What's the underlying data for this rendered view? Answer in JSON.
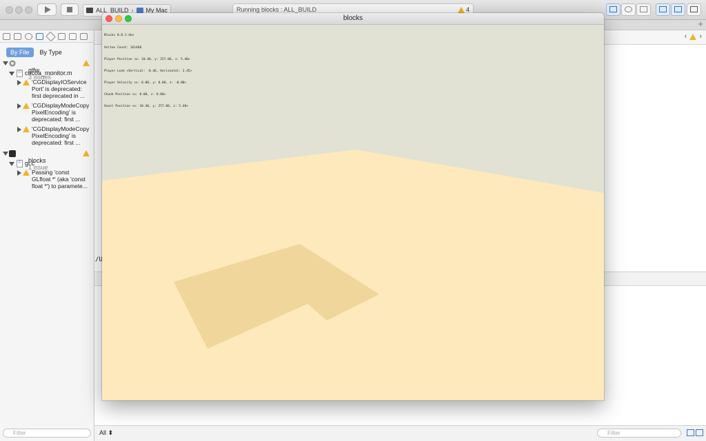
{
  "toolbar": {
    "scheme": "ALL_BUILD",
    "destination": "My Mac",
    "separator": "›",
    "activity_status": "Running blocks : ALL_BUILD",
    "warning_count": "4"
  },
  "navigator": {
    "tabs": {
      "by_file": "By File",
      "by_type": "By Type"
    },
    "filter_placeholder": "Filter",
    "groups": [
      {
        "project": "glfw",
        "issue_count": "3 issues",
        "file": "cocoa_monitor.m",
        "issues": [
          [
            "'CGDisplayIOService",
            "Port' is deprecated:",
            "first deprecated in ..."
          ],
          [
            "'CGDisplayModeCopy",
            "PixelEncoding' is",
            "deprecated: first ..."
          ],
          [
            "'CGDisplayModeCopy",
            "PixelEncoding' is",
            "deprecated: first ..."
          ]
        ]
      },
      {
        "project": "blocks",
        "issue_count": "1 issue",
        "file": "gl.c",
        "issues": [
          [
            "Passing 'const",
            "GLfloat *' (aka 'const",
            "float *') to paramete..."
          ]
        ]
      }
    ]
  },
  "editor": {
    "path_fragment": "/U"
  },
  "debug": {
    "scope_label": "All",
    "filter_placeholder": "Filter"
  },
  "game_window": {
    "title": "blocks",
    "hud": [
      "Blocks 0.0.1-dev",
      "Vertex Count: 161460",
      "Player Position <x: 10.40, y: 257.06, z: 5.40>",
      "Player Look <Vertical: -0.46, Horizontal: 2.45>",
      "Player Velocity <x: 0.00, y: 0.00, z: -0.00>",
      "Chunk Position <x: 0.00, z: 0.00>",
      "Voxel Position <x: 10.40, y: 257.00, z: 5.40>"
    ],
    "colors": {
      "sky": "#e1e1d4",
      "ground": "#fde9bb",
      "shadow": "#f0d69a"
    }
  }
}
